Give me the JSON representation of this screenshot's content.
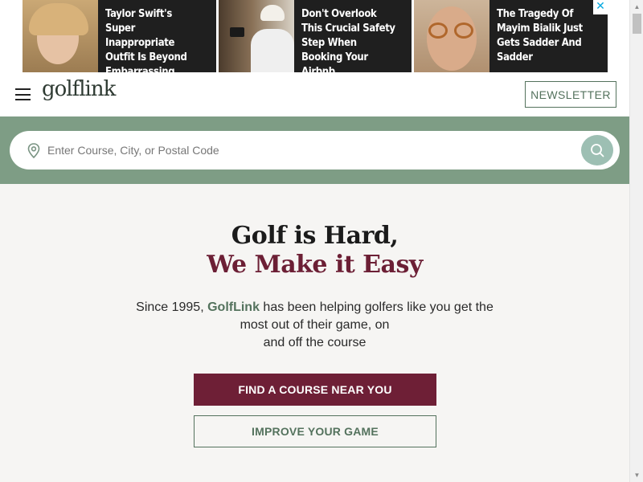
{
  "ads": {
    "tiles": [
      {
        "headline": "Taylor Swift's Super Inappropriate Outfit Is Beyond Embarrassing",
        "image_icon": "celebrity-photo"
      },
      {
        "headline": "Don't Overlook This Crucial Safety Step When Booking Your Airbnb",
        "image_icon": "door-lock-photo"
      },
      {
        "headline": "The Tragedy Of Mayim Bialik Just Gets Sadder And Sadder",
        "image_icon": "celebrity-photo"
      }
    ],
    "close_label": "✕",
    "accent_color": "#00a8e0"
  },
  "header": {
    "menu_icon": "hamburger-menu-icon",
    "logo_text": "golflink",
    "newsletter_label": "NEWSLETTER"
  },
  "search": {
    "placeholder": "Enter Course, City, or Postal Code",
    "value": "",
    "pin_icon": "location-pin-icon",
    "button_icon": "search-icon"
  },
  "hero": {
    "title": "Golf is Hard,",
    "subtitle": "We Make it Easy",
    "desc_prefix": "Since 1995, ",
    "desc_brand": "GolfLink",
    "desc_line1_rest": " has been helping golfers like you get the",
    "desc_line2": "most out of their game, on",
    "desc_line3": "and off the course",
    "primary_cta": "FIND A COURSE NEAR YOU",
    "secondary_cta": "IMPROVE YOUR GAME"
  },
  "colors": {
    "brand_green": "#54725d",
    "search_band": "#7e9d85",
    "burgundy": "#6e1f36",
    "background": "#f6f5f3"
  },
  "scrollbar": {
    "up_arrow": "▲",
    "down_arrow": "▼"
  }
}
